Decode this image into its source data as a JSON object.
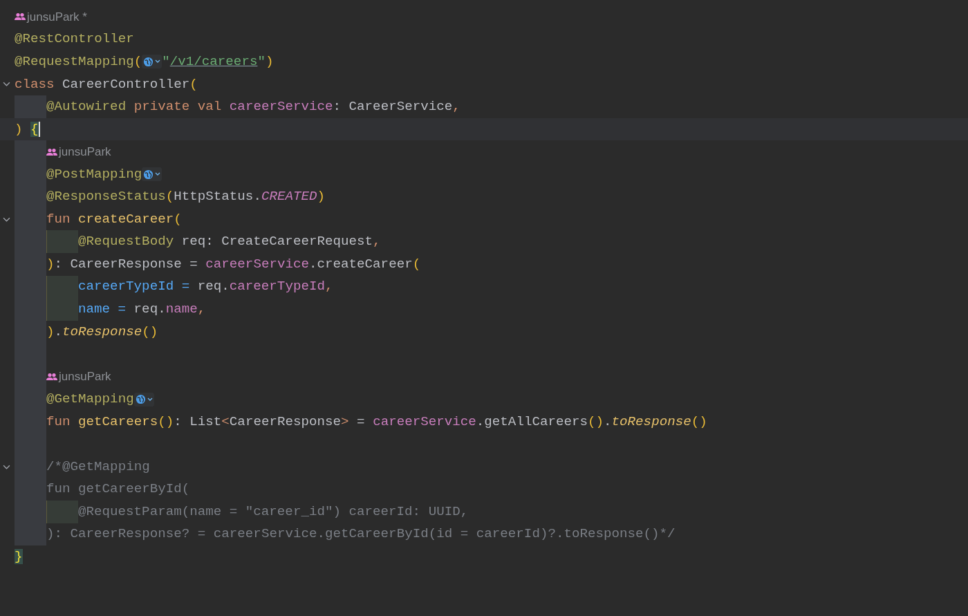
{
  "editor": {
    "lines": [
      {
        "kind": "author",
        "text": "junsuPark *"
      },
      {
        "kind": "code",
        "tokens": [
          {
            "kind": "annotation",
            "text": "@RestController"
          }
        ]
      },
      {
        "kind": "code",
        "tokens": [
          {
            "kind": "annotation",
            "text": "@RequestMapping"
          },
          {
            "kind": "paren",
            "text": "("
          },
          {
            "kind": "inlay"
          },
          {
            "kind": "string",
            "text": "\""
          },
          {
            "kind": "link",
            "text": "/v1/careers"
          },
          {
            "kind": "string",
            "text": "\""
          },
          {
            "kind": "paren",
            "text": ")"
          }
        ]
      },
      {
        "kind": "code",
        "expanded": true,
        "tokens": [
          {
            "kind": "keyword",
            "text": "class "
          },
          {
            "kind": "plain",
            "text": "CareerController"
          },
          {
            "kind": "paren",
            "text": "("
          }
        ],
        "children": [
          {
            "kind": "code",
            "tokens": [
              {
                "kind": "annotation",
                "text": "@Autowired "
              },
              {
                "kind": "keyword",
                "text": "private val "
              },
              {
                "kind": "property",
                "text": "careerService"
              },
              {
                "kind": "plain",
                "text": ": CareerService"
              },
              {
                "kind": "keyword",
                "text": ","
              }
            ]
          }
        ]
      },
      {
        "kind": "code",
        "current": true,
        "tokens": [
          {
            "kind": "paren",
            "text": ") "
          },
          {
            "kind": "brace-match",
            "text": "{"
          }
        ],
        "children": [
          {
            "kind": "author",
            "text": "junsuPark"
          },
          {
            "kind": "code",
            "tokens": [
              {
                "kind": "annotation",
                "text": "@PostMapping"
              },
              {
                "kind": "inlay"
              }
            ]
          },
          {
            "kind": "code",
            "tokens": [
              {
                "kind": "annotation",
                "text": "@ResponseStatus"
              },
              {
                "kind": "paren",
                "text": "("
              },
              {
                "kind": "plain",
                "text": "HttpStatus."
              },
              {
                "kind": "constant",
                "text": "CREATED"
              },
              {
                "kind": "paren",
                "text": ")"
              }
            ]
          },
          {
            "kind": "code",
            "expanded": true,
            "tokens": [
              {
                "kind": "keyword",
                "text": "fun "
              },
              {
                "kind": "function",
                "text": "createCareer"
              },
              {
                "kind": "paren",
                "text": "("
              }
            ],
            "children": [
              {
                "kind": "code",
                "tokens": [
                  {
                    "kind": "annotation",
                    "text": "@RequestBody "
                  },
                  {
                    "kind": "plain",
                    "text": "req: CreateCareerRequest"
                  },
                  {
                    "kind": "keyword",
                    "text": ","
                  }
                ]
              }
            ]
          },
          {
            "kind": "code",
            "tokens": [
              {
                "kind": "paren",
                "text": ")"
              },
              {
                "kind": "plain",
                "text": ": CareerResponse = "
              },
              {
                "kind": "property",
                "text": "careerService"
              },
              {
                "kind": "plain",
                "text": ".createCareer"
              },
              {
                "kind": "paren",
                "text": "("
              }
            ],
            "children": [
              {
                "kind": "code",
                "tokens": [
                  {
                    "kind": "named-arg",
                    "text": "careerTypeId = "
                  },
                  {
                    "kind": "plain",
                    "text": "req."
                  },
                  {
                    "kind": "property",
                    "text": "careerTypeId"
                  },
                  {
                    "kind": "keyword",
                    "text": ","
                  }
                ]
              },
              {
                "kind": "code",
                "tokens": [
                  {
                    "kind": "named-arg",
                    "text": "name = "
                  },
                  {
                    "kind": "plain",
                    "text": "req."
                  },
                  {
                    "kind": "property",
                    "text": "name"
                  },
                  {
                    "kind": "keyword",
                    "text": ","
                  }
                ]
              }
            ]
          },
          {
            "kind": "code",
            "tokens": [
              {
                "kind": "paren",
                "text": ")"
              },
              {
                "kind": "plain",
                "text": "."
              },
              {
                "kind": "extension",
                "text": "toResponse"
              },
              {
                "kind": "paren",
                "text": "()"
              }
            ]
          },
          {
            "kind": "blank"
          },
          {
            "kind": "author",
            "text": "junsuPark"
          },
          {
            "kind": "code",
            "tokens": [
              {
                "kind": "annotation",
                "text": "@GetMapping"
              },
              {
                "kind": "inlay"
              }
            ]
          },
          {
            "kind": "code",
            "tokens": [
              {
                "kind": "keyword",
                "text": "fun "
              },
              {
                "kind": "function",
                "text": "getCareers"
              },
              {
                "kind": "paren",
                "text": "()"
              },
              {
                "kind": "plain",
                "text": ": List"
              },
              {
                "kind": "keyword",
                "text": "<"
              },
              {
                "kind": "plain",
                "text": "CareerResponse"
              },
              {
                "kind": "keyword",
                "text": ">"
              },
              {
                "kind": "plain",
                "text": " = "
              },
              {
                "kind": "property",
                "text": "careerService"
              },
              {
                "kind": "plain",
                "text": ".getAllCareers"
              },
              {
                "kind": "paren",
                "text": "()"
              },
              {
                "kind": "plain",
                "text": "."
              },
              {
                "kind": "extension",
                "text": "toResponse"
              },
              {
                "kind": "paren",
                "text": "()"
              }
            ]
          },
          {
            "kind": "blank"
          },
          {
            "kind": "code",
            "expanded": true,
            "tokens": [
              {
                "kind": "comment",
                "text": "/*@GetMapping"
              }
            ]
          },
          {
            "kind": "code",
            "tokens": [
              {
                "kind": "comment",
                "text": "fun getCareerById("
              }
            ],
            "children": [
              {
                "kind": "code",
                "tokens": [
                  {
                    "kind": "comment",
                    "text": "@RequestParam(name = \"career_id\") careerId: UUID,"
                  }
                ]
              }
            ]
          },
          {
            "kind": "code",
            "tokens": [
              {
                "kind": "comment",
                "text": "): CareerResponse? = careerService.getCareerById(id = careerId)?.toResponse()*/"
              }
            ]
          }
        ]
      },
      {
        "kind": "code",
        "tokens": [
          {
            "kind": "brace-match",
            "text": "}"
          }
        ]
      }
    ]
  }
}
